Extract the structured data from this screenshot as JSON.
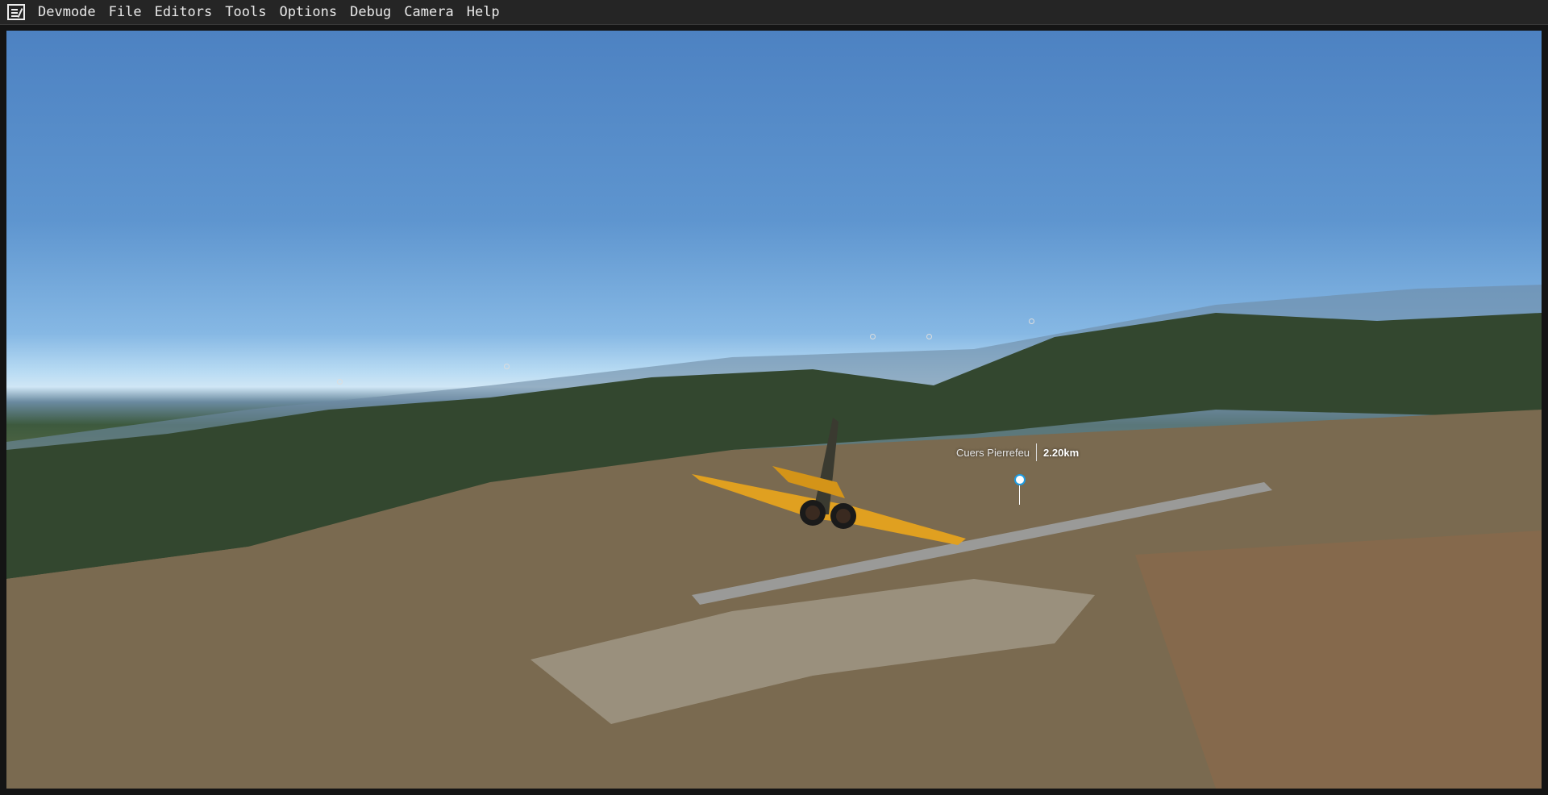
{
  "menubar": {
    "items": [
      "Devmode",
      "File",
      "Editors",
      "Tools",
      "Options",
      "Debug",
      "Camera",
      "Help"
    ]
  },
  "viewport": {
    "poi": {
      "name": "Cuers Pierrefeu",
      "distance": "2.20km"
    },
    "aircraft_color": "#e0a020"
  }
}
